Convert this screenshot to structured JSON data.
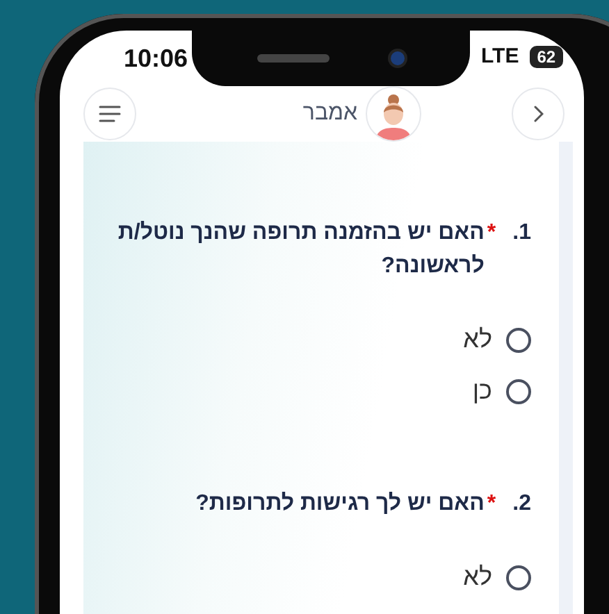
{
  "status_bar": {
    "time": "10:06",
    "network": "LTE",
    "battery": "62"
  },
  "header": {
    "name": "אמבר"
  },
  "questions": [
    {
      "number": "1.",
      "required": true,
      "required_mark": "*",
      "text": "האם יש בהזמנה תרופה שהנך נוטל/ת לראשונה?",
      "options": [
        {
          "label": "לא",
          "selected": false
        },
        {
          "label": "כן",
          "selected": false
        }
      ]
    },
    {
      "number": "2.",
      "required": true,
      "required_mark": "*",
      "text": "האם יש לך רגישות לתרופות?",
      "options": [
        {
          "label": "לא",
          "selected": false
        }
      ]
    }
  ]
}
